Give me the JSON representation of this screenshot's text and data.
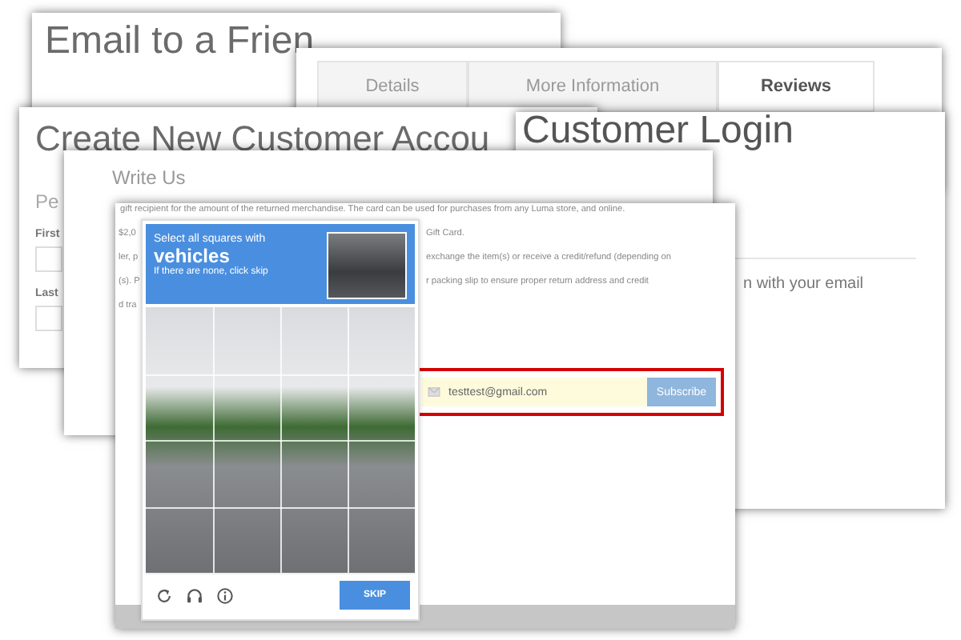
{
  "email_friend": {
    "title": "Email to a Frien"
  },
  "product_tabs": {
    "tabs": [
      {
        "label": "Details",
        "selected": false
      },
      {
        "label": "More Information",
        "selected": false
      },
      {
        "label": "Reviews",
        "selected": true
      }
    ]
  },
  "create_account": {
    "title": "Create New Customer Accou",
    "section": "Pe",
    "fields": [
      {
        "label": "First"
      },
      {
        "label": "Last"
      }
    ]
  },
  "customer_login": {
    "title": "Customer Login",
    "text": "n with your email"
  },
  "write_us": {
    "title": "Write Us"
  },
  "returns": {
    "intro": "gift recipient for the amount of the returned merchandise. The card can be used for purchases from any Luma store, and online.",
    "rows": [
      {
        "left": "$2,0",
        "right": "Gift Card."
      },
      {
        "left": "ler, p",
        "right": "exchange the item(s) or receive a credit/refund (depending on"
      },
      {
        "left": "(s). P",
        "right": "r packing slip to ensure proper return address and credit"
      },
      {
        "left": "d tra"
      }
    ]
  },
  "subscribe": {
    "value": "testtest@gmail.com",
    "button": "Subscribe"
  },
  "captcha": {
    "prompt": "Select all squares with",
    "target": "vehicles",
    "hint": "If there are none, click skip",
    "button": "SKIP"
  }
}
